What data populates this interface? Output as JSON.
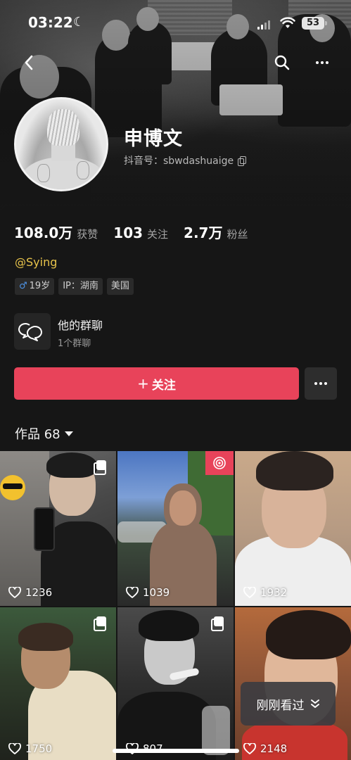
{
  "status_bar": {
    "time": "03:22",
    "battery": "53"
  },
  "profile": {
    "name": "申博文",
    "douyin_id_label": "抖音号：",
    "douyin_id": "sbwdashuaige",
    "stats": [
      {
        "value": "108.0万",
        "label": "获赞"
      },
      {
        "value": "103",
        "label": "关注"
      },
      {
        "value": "2.7万",
        "label": "粉丝"
      }
    ],
    "mention": "@Sying",
    "tags": {
      "gender_age": "19岁",
      "ip": "IP：湖南",
      "country": "美国"
    },
    "group": {
      "title": "他的群聊",
      "subtitle": "1个群聊"
    },
    "follow_label": "关注"
  },
  "works": {
    "tab_label": "作品 68"
  },
  "videos": [
    {
      "likes": "1236"
    },
    {
      "likes": "1039"
    },
    {
      "likes": "1932"
    },
    {
      "likes": "1750"
    },
    {
      "likes": "807"
    },
    {
      "likes": "2148"
    }
  ],
  "recently_viewed": "刚刚看过",
  "colors": {
    "accent": "#e8435a",
    "mention": "#e7c34b",
    "background": "#161616",
    "male": "#4e95e8"
  }
}
